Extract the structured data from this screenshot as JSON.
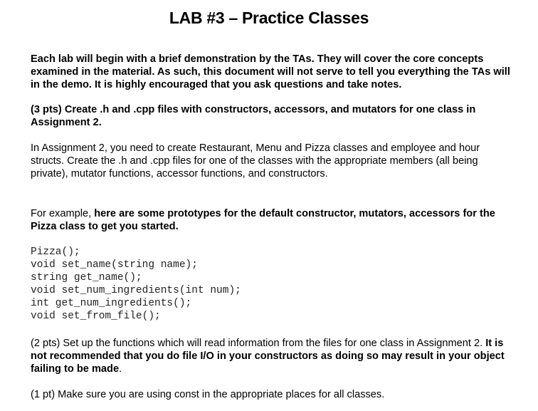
{
  "title": "LAB #3 – Practice Classes",
  "intro": "Each lab will begin with a brief demonstration by the TAs. They will cover the core concepts examined in the material. As such, this document will not serve to tell you everything the TAs will in the demo. It is highly encouraged that you ask questions and take notes.",
  "task1": {
    "heading": "(3 pts) Create .h and .cpp files with constructors, accessors, and mutators for one class in Assignment 2.",
    "body": "In Assignment 2, you need to create Restaurant, Menu and Pizza classes and employee and hour structs. Create the .h and .cpp files for one of the classes with the appropriate members (all being private), mutator functions, accessor functions, and constructors.",
    "example_prefix": "For example, ",
    "example_bold": "here are some prototypes for the default constructor, mutators, accessors for the Pizza class to get you started.",
    "code": [
      "Pizza();",
      "void set_name(string name);",
      "string get_name();",
      "void set_num_ingredients(int num);",
      "int get_num_ingredients();",
      "void set_from_file();"
    ]
  },
  "task2": {
    "normal": "(2 pts) Set up the functions which will read information from the files for one class in Assignment 2. ",
    "bold": "It is not recommended that you do file I/O in your constructors as doing so may result in your object failing to be made",
    "end": "."
  },
  "task3": {
    "text": "(1 pt) Make sure you are using const in the appropriate places for all classes."
  }
}
